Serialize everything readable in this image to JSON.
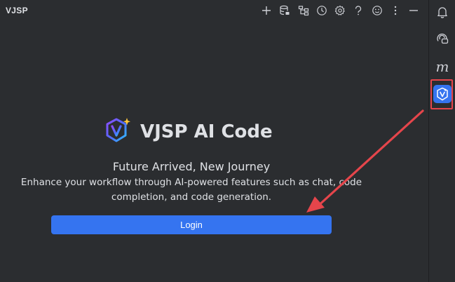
{
  "header": {
    "title": "VJSP"
  },
  "toolbar": {
    "icons": [
      "plus-icon",
      "database-icon",
      "hierarchy-icon",
      "history-icon",
      "settings-icon",
      "help-icon",
      "emoji-icon",
      "more-icon",
      "minimize-icon"
    ]
  },
  "strip": {
    "icons": [
      "notifications-icon",
      "ai-chat-icon",
      "m-icon",
      "vjsp-shield-icon"
    ],
    "m_label": "m",
    "active": "vjsp-shield-icon"
  },
  "main": {
    "brand_name": "VJSP AI Code",
    "tagline": "Future Arrived, New Journey",
    "description": "Enhance your workflow through AI-powered features such as chat, code completion, and code generation.",
    "login_label": "Login"
  },
  "colors": {
    "background": "#2b2d30",
    "accent": "#3574f0",
    "highlight": "#e5454b",
    "text": "#dfe1e5"
  }
}
